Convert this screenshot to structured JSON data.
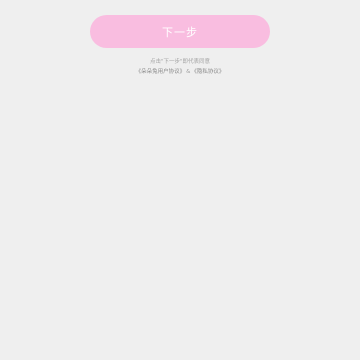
{
  "next_button": {
    "label": "下一步",
    "bg_color": "#f9bde0",
    "text_color": "#ffffff"
  },
  "consent": {
    "notice": "点击\"下一步\"即代表同意",
    "user_agreement_link": "《朵朵兔用户协议》",
    "separator": "&",
    "privacy_policy_link": "《隐私协议》"
  },
  "colors": {
    "background": "#efefef",
    "muted_text": "#a2a2a2",
    "link_text": "#8a8a8a"
  }
}
